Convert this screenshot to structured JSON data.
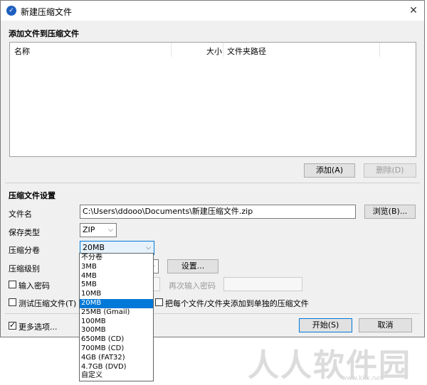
{
  "window": {
    "title": "新建压缩文件",
    "close_glyph": "✕"
  },
  "add_section": {
    "title": "添加文件到压缩文件",
    "columns": [
      "名称",
      "大小",
      "文件夹路径"
    ],
    "add_button": "添加(A)",
    "delete_button": "删除(D)"
  },
  "settings": {
    "title": "压缩文件设置",
    "filename_label": "文件名",
    "filename_value": "C:\\Users\\ddooo\\Documents\\新建压缩文件.zip",
    "browse_button": "浏览(B)...",
    "type_label": "保存类型",
    "type_value": "ZIP",
    "split_label": "压缩分卷",
    "split_value": "20MB",
    "level_label": "压缩级别",
    "settings_button": "设置...",
    "password_label": "输入密码",
    "repeat_password_label": "再次输入密码",
    "test_label": "测试压缩文件(T)",
    "each_file_label": "把每个文件/文件夹添加到单独的压缩文件",
    "more_options_label": "更多选项...",
    "start_button": "开始(S)",
    "cancel_button": "取消"
  },
  "split_options": [
    "不分卷",
    "3MB",
    "4MB",
    "5MB",
    "10MB",
    "20MB",
    "25MB (Gmail)",
    "100MB",
    "300MB",
    "650MB (CD)",
    "700MB (CD)",
    "4GB (FAT32)",
    "4.7GB (DVD)",
    "自定义"
  ],
  "split_selected_index": 5,
  "watermark": {
    "text": "人人软件园",
    "url": "www.kkx.net"
  },
  "colors": {
    "accent": "#0078d7",
    "window_bg": "#f0f0f0",
    "icon_blue": "#1e5fbf"
  }
}
